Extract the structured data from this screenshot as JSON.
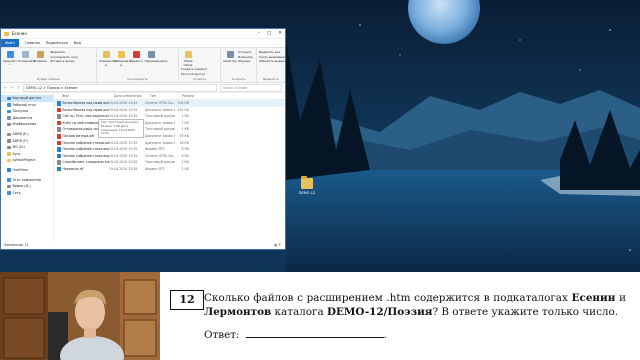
{
  "explorer": {
    "title": "Есенин",
    "ribbon_tabs": [
      "Файл",
      "Главная",
      "Поделиться",
      "Вид"
    ],
    "ribbon": {
      "clipboard": {
        "label": "Буфер обмена",
        "pin": "Закрепить на панели быстрого доступа",
        "copy": "Копировать",
        "paste": "Вставить",
        "cut": "Вырезать",
        "copy_path": "Скопировать путь",
        "paste_shortcut": "Вставить ярлык"
      },
      "organize": {
        "label": "Упорядочить",
        "move_to": "Переместить в",
        "copy_to": "Копировать в",
        "delete": "Удалить",
        "rename": "Переименовать"
      },
      "new": {
        "label": "Создать",
        "new_folder": "Новая папка",
        "new_item": "Создать элемент",
        "easy_access": "Простой доступ"
      },
      "open": {
        "label": "Открыть",
        "properties": "Свойства",
        "open": "Открыть",
        "edit": "Изменить",
        "history": "Журнал"
      },
      "select": {
        "label": "Выделить",
        "select_all": "Выделить все",
        "select_none": "Снять выделение",
        "invert": "Обратить выделение"
      }
    },
    "address": {
      "path": "DEMO-12  >  Поэзия  >  Есенин",
      "search_placeholder": "Поиск: Есенин"
    },
    "nav_items": [
      {
        "label": "Быстрый доступ",
        "icon": "star-icon",
        "color": "#2f7bd8"
      },
      {
        "label": "Рабочий стол",
        "icon": "desktop-icon",
        "color": "#3b8fe0"
      },
      {
        "label": "Загрузки",
        "icon": "download-icon",
        "color": "#3b8fe0"
      },
      {
        "label": "Документы",
        "icon": "document-icon",
        "color": "#7a8fa6"
      },
      {
        "label": "Изображения",
        "icon": "image-icon",
        "color": "#7a8fa6"
      },
      {
        "label": "ADRB (E:)",
        "icon": "drive-icon",
        "color": "#8a8a8a"
      },
      {
        "label": "ADRB (F:)",
        "icon": "drive-icon",
        "color": "#8a8a8a"
      },
      {
        "label": "MG (D:)",
        "icon": "drive-icon",
        "color": "#8a8a8a"
      },
      {
        "label": "Sync",
        "icon": "folder-icon",
        "color": "#e8c15a"
      },
      {
        "label": "pythonProject",
        "icon": "folder-icon",
        "color": "#e8c15a"
      },
      {
        "label": "OneDrive",
        "icon": "cloud-icon",
        "color": "#2a7fd4"
      },
      {
        "label": "Этот компьютер",
        "icon": "computer-icon",
        "color": "#3b8fe0"
      },
      {
        "label": "Видео (D:)",
        "icon": "drive-icon",
        "color": "#8a8a8a"
      },
      {
        "label": "Сеть",
        "icon": "network-icon",
        "color": "#3b8fe0"
      }
    ],
    "columns": [
      "Имя",
      "Дата изменения",
      "Тип",
      "Размер"
    ],
    "files": [
      {
        "name": "Белая береза под моим окном...htm",
        "date": "19.04.2020 13:54",
        "type": "Chrome HTML Do...",
        "size": "105 КБ",
        "color": "#2f7bd8"
      },
      {
        "name": "Белая береза под моим окном.....pdf",
        "date": "19.04.2020 13:55",
        "type": "Документ Adobe Acrobat",
        "size": "101 КБ",
        "color": "#d83b2f"
      },
      {
        "name": "Гой ты, Русь, моя родная.txt",
        "date": "19.04.2020 13:55",
        "type": "Текстовый документ",
        "size": "1 КБ",
        "color": "#8a8a8a"
      },
      {
        "name": "Клён ты мой опавший.pdf",
        "date": "19.04.2020 13:55",
        "type": "Документ Adobe Acrobat",
        "size": "7 КБ",
        "color": "#d83b2f"
      },
      {
        "name": "Отговорила роща золотая.txt",
        "date": "19.04.2020 13:55",
        "type": "Текстовый документ",
        "size": "1 КБ",
        "color": "#8a8a8a"
      },
      {
        "name": "Письмо матери.pdf",
        "date": "19.04.2020 13:55",
        "type": "Документ Adobe Acrobat",
        "size": "33 КБ",
        "color": "#d83b2f"
      },
      {
        "name": "Полное собрание стихов.pdf",
        "date": "19.04.2020 13:55",
        "type": "Документ Adobe Acrobat",
        "size": "18 КБ",
        "color": "#d83b2f"
      },
      {
        "name": "Полное собрание стихотворений.rtf",
        "date": "19.04.2020 13:55",
        "type": "Формат RTF",
        "size": "8 КБ",
        "color": "#2f7bd8"
      },
      {
        "name": "Полное собрание стихотворений.htm",
        "date": "19.04.2020 13:55",
        "type": "Chrome HTML Do...",
        "size": "8 КБ",
        "color": "#2f7bd8"
      },
      {
        "name": "Спасибо вам, стариканы.txt",
        "date": "19.04.2020 13:55",
        "type": "Текстовый документ",
        "size": "2 КБ",
        "color": "#8a8a8a"
      },
      {
        "name": "Черемуха.rtf",
        "date": "19.04.2020 13:55",
        "type": "Формат RTF",
        "size": "1 КБ",
        "color": "#2f7bd8"
      }
    ],
    "tooltip": "Тип: Текстовый документ Размер: 5 КБ Дата изменения: 19.04.2020 13:55",
    "status": "Элементов: 11",
    "views": "▦ ☰"
  },
  "desktop": {
    "folder_label": "DEMO-12"
  },
  "question": {
    "number": "12",
    "text_part1": "Сколько файлов с расширением .htm содержится в подкаталогах ",
    "bold1": "Есенин",
    "text_part2": " и ",
    "bold2": "Лермонтов",
    "text_part3": " каталога ",
    "bold3": "DEMO-12/Поэзия",
    "text_part4": "? В ответе укажите только число.",
    "answer_label": "Ответ:"
  },
  "colors": {
    "accent": "#1a6fc4",
    "selection": "#cce4f7",
    "sky": "#0b2540"
  }
}
